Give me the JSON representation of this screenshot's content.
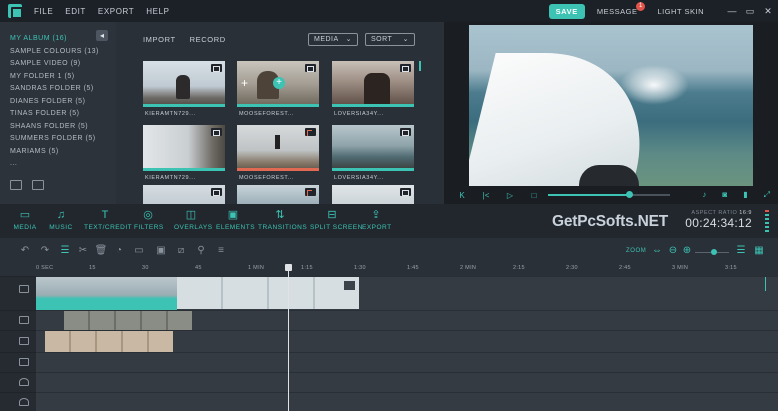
{
  "app": {
    "menu": [
      "FILE",
      "EDIT",
      "EXPORT",
      "HELP"
    ],
    "save_label": "SAVE",
    "messages_label": "MESSAGE",
    "messages_count": "1",
    "skin_label": "LIGHT SKIN",
    "window_buttons": [
      "—",
      "▭",
      "✕"
    ]
  },
  "sidebar": {
    "items": [
      {
        "label": "MY ALBUM (16)",
        "active": true
      },
      {
        "label": "SAMPLE COLOURS (13)"
      },
      {
        "label": "SAMPLE VIDEO (9)"
      },
      {
        "label": "MY FOLDER 1 (5)"
      },
      {
        "label": "SANDRAS FOLDER (5)"
      },
      {
        "label": "DIANES FOLDER (5)"
      },
      {
        "label": "TINAS FOLDER (5)"
      },
      {
        "label": "SHAANS FOLDER (5)"
      },
      {
        "label": "SUMMERS FOLDER (5)"
      },
      {
        "label": "MARIAMS (5)"
      },
      {
        "label": "..."
      }
    ]
  },
  "media": {
    "tabs": [
      "IMPORT",
      "RECORD"
    ],
    "filter_label": "MEDIA",
    "sort_label": "SORT",
    "thumbnails": [
      {
        "caption": "KIERAMTN729...",
        "kind": "video"
      },
      {
        "caption": "MOOSEFOREST...",
        "kind": "video"
      },
      {
        "caption": "LOVERSIA34Y...",
        "kind": "video"
      },
      {
        "caption": "KIERAMTN729...",
        "kind": "video"
      },
      {
        "caption": "MOOSEFOREST...",
        "kind": "music"
      },
      {
        "caption": "LOVERSIA34Y...",
        "kind": "video"
      },
      {
        "caption": "",
        "kind": "video"
      },
      {
        "caption": "",
        "kind": "music"
      },
      {
        "caption": "",
        "kind": "video"
      }
    ]
  },
  "preview": {
    "controls": [
      "skip-back",
      "step-back",
      "play",
      "stop"
    ],
    "progress": 0.66,
    "right_controls": [
      "microphone",
      "camera",
      "volume",
      "fullscreen"
    ]
  },
  "toolbar": {
    "tools": [
      {
        "label": "MEDIA",
        "icon": "folder-icon"
      },
      {
        "label": "MUSIC",
        "icon": "music-icon"
      },
      {
        "label": "TEXT/CREDIT",
        "icon": "text-icon"
      },
      {
        "label": "FILTERS",
        "icon": "filters-icon"
      },
      {
        "label": "OVERLAYS",
        "icon": "overlays-icon"
      },
      {
        "label": "ELEMENTS",
        "icon": "elements-icon"
      },
      {
        "label": "TRANSITIONS",
        "icon": "transitions-icon"
      },
      {
        "label": "SPLIT SCREEN",
        "icon": "split-screen-icon"
      },
      {
        "label": "EXPORT",
        "icon": "export-icon"
      }
    ],
    "watermark": "GetPcSofts.NET",
    "aspect_ratio_label": "ASPECT RATIO",
    "aspect_ratio_value": "16:9",
    "timecode": "00:24:34:12"
  },
  "editbar": {
    "zoom_label": "ZOOM",
    "zoom_level": 0.55
  },
  "timeline": {
    "ticks": [
      "0 SEC",
      "15",
      "30",
      "45",
      "1 MIN",
      "1:15",
      "1:30",
      "1:45",
      "2 MIN",
      "2:15",
      "2:30",
      "2:45",
      "3 MIN",
      "3:15"
    ],
    "playhead_time": "1:06",
    "tracks": [
      "video",
      "video",
      "image",
      "image",
      "audio",
      "audio"
    ]
  },
  "colors": {
    "accent": "#3cc3b4",
    "alert": "#e2534a",
    "background": "#2a3038"
  }
}
